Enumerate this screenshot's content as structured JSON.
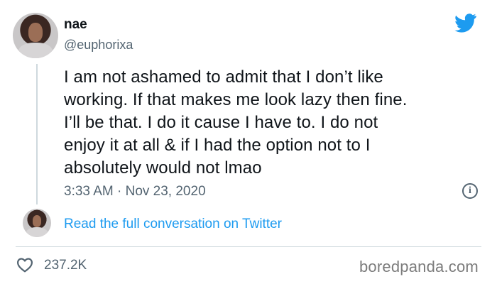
{
  "tweet": {
    "author": {
      "display_name": "nae",
      "handle": "@euphorixa"
    },
    "brand_icon": "twitter-bird-icon",
    "text_lines": [
      "I am not ashamed to admit that I don’t like",
      "working. If that makes me look lazy then fine.",
      "I’ll be that. I do it cause I have to. I do not",
      "enjoy it at all & if I had the option not to I",
      "absolutely would not lmao"
    ],
    "time": "3:33 AM",
    "separator": " · ",
    "date": "Nov 23, 2020",
    "info_icon": "info-icon",
    "read_conversation": "Read the full conversation on Twitter",
    "likes": "237.2K",
    "like_icon": "heart-icon"
  },
  "watermark": "boredpanda.com",
  "colors": {
    "text": "#0f1419",
    "secondary": "#536471",
    "accent": "#1d9bf0",
    "divider": "#cfd9de",
    "watermark": "#7c7c7c"
  }
}
